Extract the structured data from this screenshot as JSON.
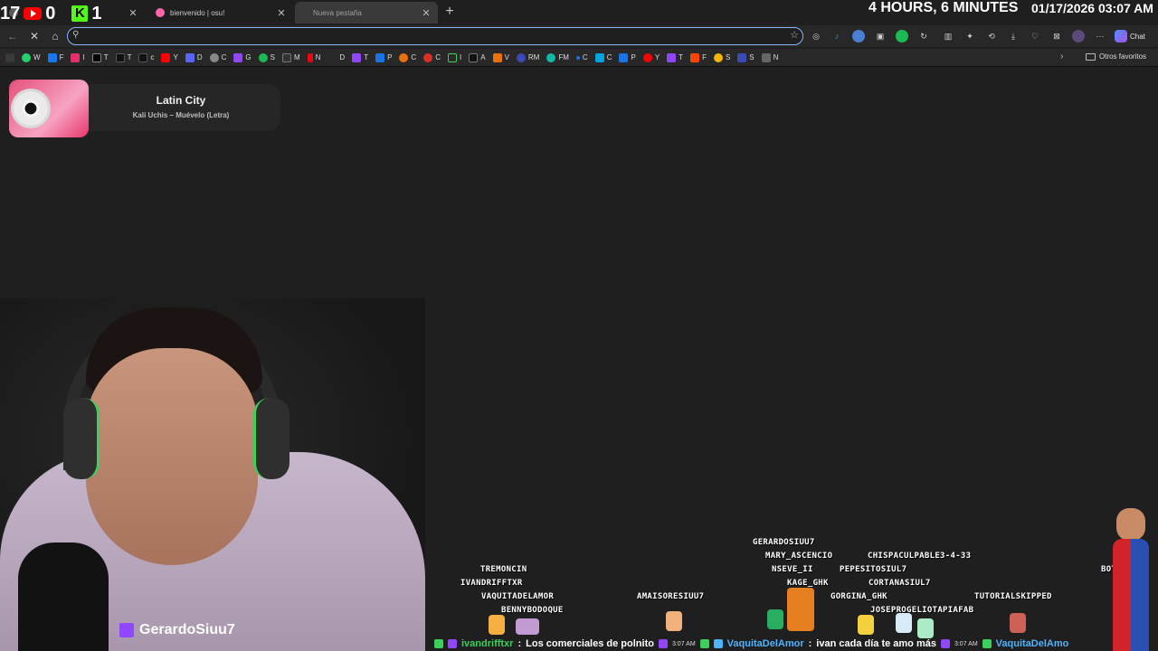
{
  "overlay": {
    "counter_a": "17",
    "counter_youtube": "0",
    "counter_kick": "1",
    "timer": "4 HOURS, 6 MINUTES",
    "datetime": "01/17/2026 03:07 AM"
  },
  "tabs": [
    {
      "title": "",
      "active": false,
      "favicon_color": "#5c5c5c"
    },
    {
      "title": "bienvenido | osu!",
      "active": false,
      "favicon_color": "#ff66aa"
    },
    {
      "title": "Nueva pestaña",
      "active": true,
      "favicon_color": ""
    }
  ],
  "omnibox": {
    "value": "",
    "placeholder": ""
  },
  "toolbar": {
    "chat_label": "Chat"
  },
  "bookmarks": [
    {
      "label": "W",
      "color": "#25d366"
    },
    {
      "label": "F",
      "color": "#1877f2"
    },
    {
      "label": "I",
      "color": "#e1306c"
    },
    {
      "label": "T",
      "color": "#000000"
    },
    {
      "label": "T",
      "color": "#111111"
    },
    {
      "label": "c",
      "color": "#111111"
    },
    {
      "label": "Y",
      "color": "#ff0000"
    },
    {
      "label": "D",
      "color": "#5865f2"
    },
    {
      "label": "C",
      "color": "#888888"
    },
    {
      "label": "G",
      "color": "#9146ff"
    },
    {
      "label": "S",
      "color": "#1db954"
    },
    {
      "label": "M",
      "color": "#333333"
    },
    {
      "label": "N",
      "color": "#e50914"
    },
    {
      "label": "D",
      "color": "#282828"
    },
    {
      "label": "T",
      "color": "#9146ff"
    },
    {
      "label": "P",
      "color": "#1a73e8"
    },
    {
      "label": "C",
      "color": "#e8710a"
    },
    {
      "label": "C",
      "color": "#d93025"
    },
    {
      "label": "I",
      "color": "#2a2a2a"
    },
    {
      "label": "A",
      "color": "#111111"
    },
    {
      "label": "V",
      "color": "#e8710a"
    },
    {
      "label": "RM",
      "color": "#3c4ab3"
    },
    {
      "label": "FM",
      "color": "#14b8a6"
    },
    {
      "label": "C",
      "color": "#1a73e8"
    },
    {
      "label": "C",
      "color": "#00a3e0"
    },
    {
      "label": "P",
      "color": "#1a73e8"
    },
    {
      "label": "Y",
      "color": "#ff0000"
    },
    {
      "label": "T",
      "color": "#9146ff"
    },
    {
      "label": "F",
      "color": "#ff4500"
    },
    {
      "label": "S",
      "color": "#f4b400"
    },
    {
      "label": "S",
      "color": "#3c4ab3"
    },
    {
      "label": "N",
      "color": "#666666"
    }
  ],
  "bookmarks_folder": "Otros favoritos",
  "now_playing": {
    "title": "Latin City",
    "artist": "Kali Uchis – Muévelo (Letra)"
  },
  "streamer": {
    "handle": "GerardoSiuu7"
  },
  "stream_avatars": [
    "GERARDOSIUU7",
    "MARY_ASCENCIO",
    "CHISPACULPABLE3-4-33",
    "TREMONCIN",
    "NSEVE_II",
    "PEPESITOSIUL7",
    "BOT",
    "IVANDRIFFTXR",
    "KAGE_GHK",
    "CORTANASIUL7",
    "VAQUITADELAMOR",
    "AMAISORESIUU7",
    "GORGINA_GHK",
    "TUTORIALSKIPPED",
    "BENNYBODOQUE",
    "JOSEPROGELIOTAPIAFAB"
  ],
  "chat": [
    {
      "user": "ivandrifftxr",
      "message": "Los comerciales de polnito",
      "time": "3:07 AM"
    },
    {
      "user": "VaquitaDelAmor",
      "message": "ivan cada día te amo más",
      "time": "3:07 AM"
    },
    {
      "user": "VaquitaDelAmo",
      "message": "",
      "time": ""
    }
  ]
}
